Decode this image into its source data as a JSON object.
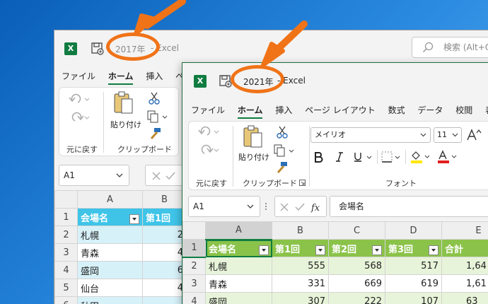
{
  "back_window": {
    "title": "2017年",
    "app": "-  Excel",
    "search_placeholder": "検索 (Alt+Q)",
    "menu": [
      "ファイル",
      "ホーム",
      "挿入",
      "ペ"
    ],
    "active_menu_index": 1,
    "groups": {
      "undo": "元に戻す",
      "clipboard": "クリップボード"
    },
    "paste_label": "貼り付け",
    "name_box": "A1",
    "col_headers": [
      "A",
      "B"
    ],
    "row_headers": [
      "1",
      "2",
      "3",
      "4",
      "5",
      "6"
    ],
    "header_row": [
      "会場名",
      "第1回"
    ],
    "rows": [
      [
        "札幌",
        "2"
      ],
      [
        "青森",
        "4"
      ],
      [
        "盛岡",
        "6"
      ],
      [
        "仙台",
        "4"
      ],
      [
        "秋田",
        ""
      ]
    ]
  },
  "front_window": {
    "title": "2021年",
    "app": "-  Excel",
    "menu": [
      "ファイル",
      "ホーム",
      "挿入",
      "ページ レイアウト",
      "数式",
      "データ",
      "校閲",
      "表示"
    ],
    "active_menu_index": 1,
    "groups": {
      "undo": "元に戻す",
      "clipboard": "クリップボード",
      "font": "フォント"
    },
    "paste_label": "貼り付け",
    "font_name": "メイリオ",
    "font_size": "11",
    "name_box": "A1",
    "formula_value": "会場名",
    "col_headers": [
      "A",
      "B",
      "C",
      "D",
      "E"
    ],
    "row_headers": [
      "1",
      "2",
      "3",
      "4"
    ],
    "header_row": [
      "会場名",
      "第1回",
      "第2回",
      "第3回",
      "合計"
    ],
    "rows": [
      [
        "札幌",
        "555",
        "568",
        "517",
        "1,64"
      ],
      [
        "青森",
        "331",
        "669",
        "619",
        "1,61"
      ],
      [
        "盛岡",
        "307",
        "222",
        "107",
        "63"
      ]
    ]
  },
  "colors": {
    "highlight": "#f07318",
    "excel_green": "#107c41",
    "table_cyan": "#3fc4e8",
    "table_green": "#8bc34a"
  },
  "icons": [
    "excel-logo-icon",
    "save-icon",
    "search-icon",
    "undo-icon",
    "redo-icon",
    "paste-icon",
    "cut-icon",
    "copy-icon",
    "format-painter-icon",
    "bold-icon",
    "italic-icon",
    "underline-icon",
    "border-icon",
    "fill-color-icon",
    "font-color-icon",
    "increase-font-icon",
    "cancel-icon",
    "confirm-icon",
    "fx-icon"
  ]
}
